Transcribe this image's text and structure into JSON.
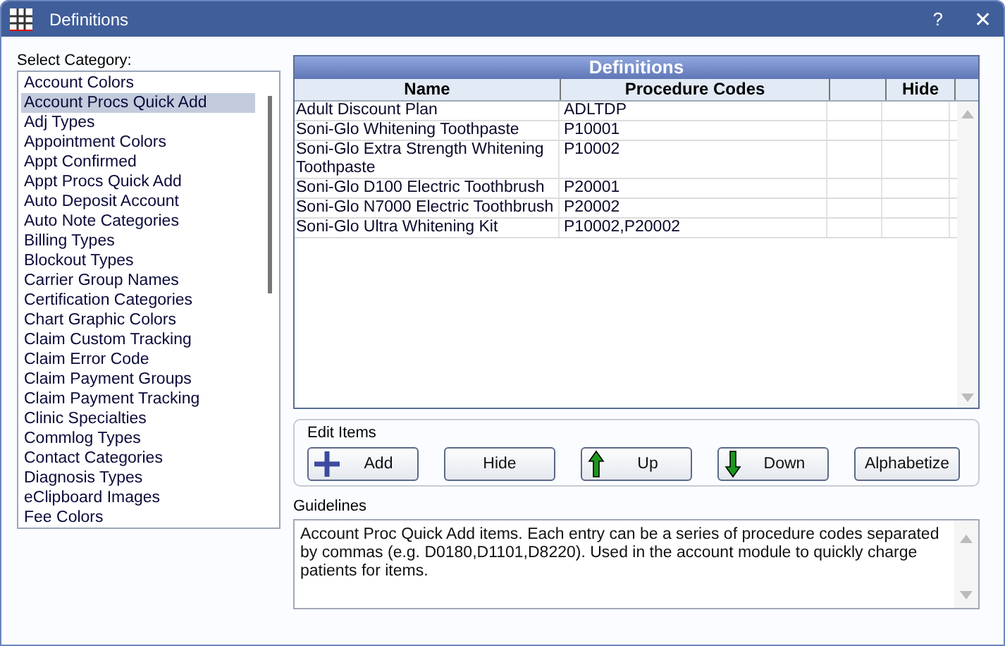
{
  "window": {
    "title": "Definitions",
    "help": "?",
    "close": "✕"
  },
  "category_label": "Select Category:",
  "categories": [
    {
      "label": "Account Colors",
      "selected": false
    },
    {
      "label": "Account Procs Quick Add",
      "selected": true
    },
    {
      "label": "Adj Types",
      "selected": false
    },
    {
      "label": "Appointment Colors",
      "selected": false
    },
    {
      "label": "Appt Confirmed",
      "selected": false
    },
    {
      "label": "Appt Procs Quick Add",
      "selected": false
    },
    {
      "label": "Auto Deposit Account",
      "selected": false
    },
    {
      "label": "Auto Note Categories",
      "selected": false
    },
    {
      "label": "Billing Types",
      "selected": false
    },
    {
      "label": "Blockout Types",
      "selected": false
    },
    {
      "label": "Carrier Group Names",
      "selected": false
    },
    {
      "label": "Certification Categories",
      "selected": false
    },
    {
      "label": "Chart Graphic Colors",
      "selected": false
    },
    {
      "label": "Claim Custom Tracking",
      "selected": false
    },
    {
      "label": "Claim Error Code",
      "selected": false
    },
    {
      "label": "Claim Payment Groups",
      "selected": false
    },
    {
      "label": "Claim Payment Tracking",
      "selected": false
    },
    {
      "label": "Clinic Specialties",
      "selected": false
    },
    {
      "label": "Commlog Types",
      "selected": false
    },
    {
      "label": "Contact Categories",
      "selected": false
    },
    {
      "label": "Diagnosis Types",
      "selected": false
    },
    {
      "label": "eClipboard Images",
      "selected": false
    },
    {
      "label": "Fee Colors",
      "selected": false
    }
  ],
  "table": {
    "title": "Definitions",
    "columns": [
      "Name",
      "Procedure Codes",
      "Hide"
    ],
    "rows": [
      {
        "name": "Adult Discount Plan",
        "codes": "ADLTDP"
      },
      {
        "name": "Soni-Glo Whitening Toothpaste",
        "codes": "P10001"
      },
      {
        "name": "Soni-Glo Extra Strength Whitening Toothpaste",
        "codes": "P10002"
      },
      {
        "name": "Soni-Glo D100 Electric Toothbrush",
        "codes": "P20001"
      },
      {
        "name": "Soni-Glo N7000 Electric Toothbrush",
        "codes": "P20002"
      },
      {
        "name": "Soni-Glo Ultra Whitening Kit",
        "codes": "P10002,P20002"
      }
    ]
  },
  "edit_items": {
    "label": "Edit Items",
    "buttons": [
      {
        "label": "Add",
        "kind": "add"
      },
      {
        "label": "Hide",
        "kind": "plain"
      },
      {
        "label": "Up",
        "kind": "up"
      },
      {
        "label": "Down",
        "kind": "down"
      },
      {
        "label": "Alphabetize",
        "kind": "plain"
      }
    ]
  },
  "guidelines": {
    "label": "Guidelines",
    "text": "Account Proc Quick Add items.  Each entry can be a series of procedure codes separated by commas (e.g. D0180,D1101,D8220).  Used in the account module to quickly charge patients for items."
  }
}
